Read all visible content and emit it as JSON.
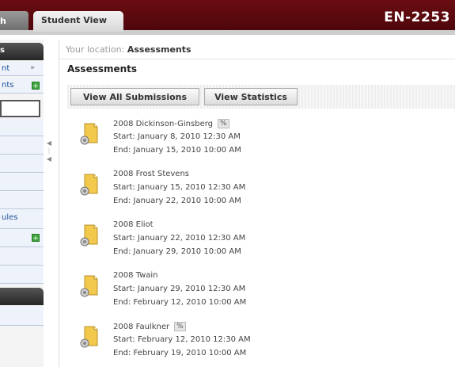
{
  "header": {
    "partial_tab_label": "h",
    "active_tab_label": "Student View",
    "course_code": "EN-2253"
  },
  "sidebar": {
    "header_label": "s",
    "item_partial_1": "nt",
    "item_partial_1_arrow": "»",
    "item_partial_2": "nts",
    "item_partial_3": "ules"
  },
  "breadcrumb": {
    "prefix": "Your location:",
    "current": "Assessments"
  },
  "page_title": "Assessments",
  "toolbar": {
    "view_all_submissions": "View All Submissions",
    "view_statistics": "View Statistics"
  },
  "assessments": [
    {
      "title": "2008 Dickinson-Ginsberg",
      "has_stats_icon": true,
      "start": "Start: January 8, 2010 12:30 AM",
      "end": "End: January 15, 2010 10:00 AM"
    },
    {
      "title": "2008 Frost Stevens",
      "has_stats_icon": false,
      "start": "Start: January 15, 2010 12:30 AM",
      "end": "End: January 22, 2010 10:00 AM"
    },
    {
      "title": "2008 Eliot",
      "has_stats_icon": false,
      "start": "Start: January 22, 2010 12:30 AM",
      "end": "End: January 29, 2010 10:00 AM"
    },
    {
      "title": "2008 Twain",
      "has_stats_icon": false,
      "start": "Start: January 29, 2010 12:30 AM",
      "end": "End: February 12, 2010 10:00 AM"
    },
    {
      "title": "2008 Faulkner",
      "has_stats_icon": true,
      "start": "Start: February 12, 2010 12:30 AM",
      "end": "End: February 19, 2010 10:00 AM"
    }
  ]
}
